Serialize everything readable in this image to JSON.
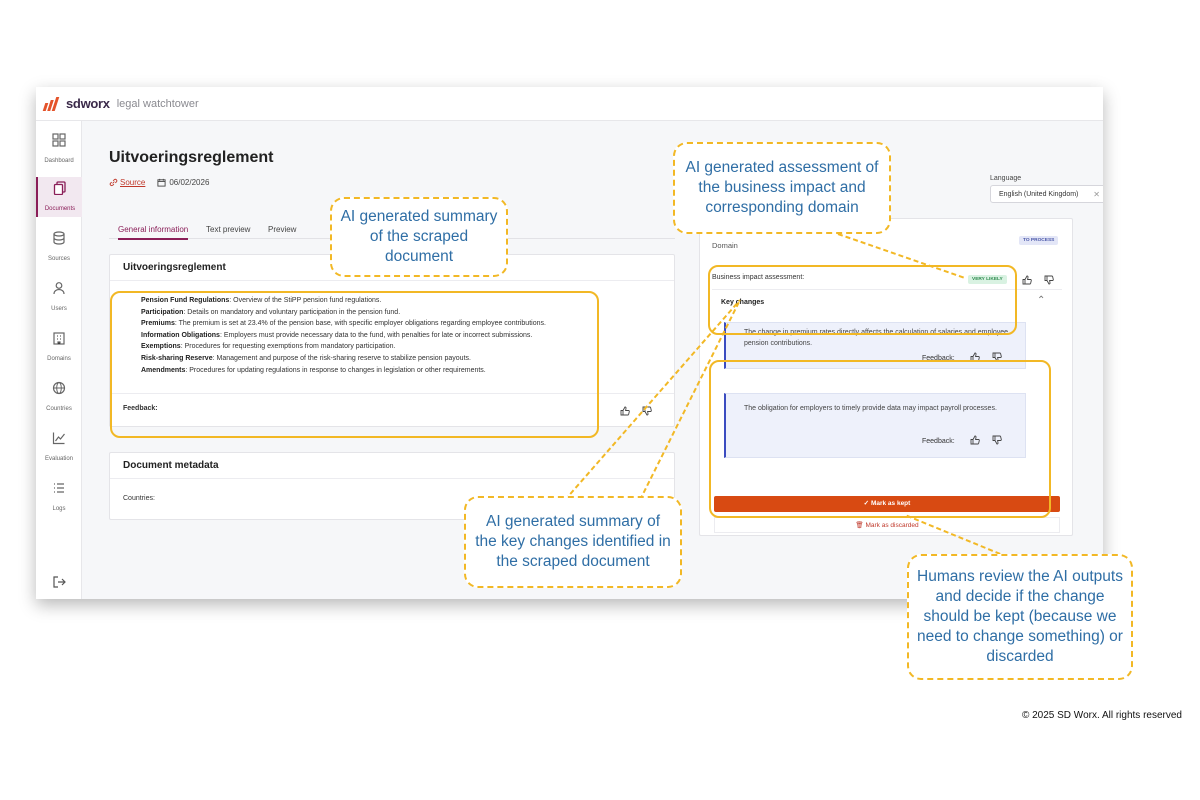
{
  "topbar": {
    "brand": "sdworx",
    "product": "legal watchtower"
  },
  "sidebar": {
    "items": [
      {
        "label": "Dashboard",
        "icon": "grid-icon"
      },
      {
        "label": "Documents",
        "icon": "documents-icon",
        "active": true
      },
      {
        "label": "Sources",
        "icon": "database-icon"
      },
      {
        "label": "Users",
        "icon": "user-icon"
      },
      {
        "label": "Domains",
        "icon": "building-icon"
      },
      {
        "label": "Countries",
        "icon": "globe-icon"
      },
      {
        "label": "Evaluation",
        "icon": "chart-icon"
      },
      {
        "label": "Logs",
        "icon": "list-icon"
      }
    ]
  },
  "page": {
    "title": "Uitvoeringsreglement",
    "source_label": "Source",
    "date": "06/02/2026"
  },
  "tabs": [
    "General information",
    "Text preview",
    "Preview"
  ],
  "summary_card": {
    "title": "Uitvoeringsreglement",
    "items": [
      {
        "term": "Pension Fund Regulations",
        "text": ": Overview of the StiPP pension fund regulations."
      },
      {
        "term": "Participation",
        "text": ": Details on mandatory and voluntary participation in the pension fund."
      },
      {
        "term": "Premiums",
        "text": ": The premium is set at 23.4% of the pension base, with specific employer obligations regarding employee contributions."
      },
      {
        "term": "Information Obligations",
        "text": ": Employers must provide necessary data to the fund, with penalties for late or incorrect submissions."
      },
      {
        "term": "Exemptions",
        "text": ": Procedures for requesting exemptions from mandatory participation."
      },
      {
        "term": "Risk-sharing Reserve",
        "text": ": Management and purpose of the risk-sharing reserve to stabilize pension payouts."
      },
      {
        "term": "Amendments",
        "text": ": Procedures for updating regulations in response to changes in legislation or other requirements."
      }
    ],
    "feedback_label": "Feedback:"
  },
  "metadata_card": {
    "title": "Document metadata",
    "countries_label": "Countries:"
  },
  "language": {
    "label": "Language",
    "value": "English (United Kingdom)"
  },
  "assessment": {
    "domain_label": "Domain",
    "status_badge": "TO PROCESS",
    "impact_label": "Business impact assessment:",
    "impact_badge": "VERY LIKELY",
    "key_changes_label": "Key changes",
    "changes": [
      {
        "text": "The change in premium rates directly affects the calculation of salaries and employee pension contributions.",
        "feedback_label": "Feedback:"
      },
      {
        "text": "The obligation for employers to timely provide data may impact payroll processes.",
        "feedback_label": "Feedback:"
      }
    ],
    "keep_label": "Mark as kept",
    "discard_label": "Mark as discarded"
  },
  "callouts": {
    "summary": "AI generated summary of the scraped document",
    "impact": "AI generated assessment of the business impact and corresponding domain",
    "key_changes": "AI generated summary of the key changes identified in the scraped document",
    "review": "Humans review the AI outputs and decide if the change should be kept (because we need to change something) or discarded"
  },
  "footer": {
    "copyright": "© 2025 SD Worx. All rights reserved"
  },
  "colors": {
    "accent": "#8a1e58",
    "primary_button": "#d84a12",
    "callout_border": "#f2b825",
    "callout_text": "#2f6ea5"
  }
}
